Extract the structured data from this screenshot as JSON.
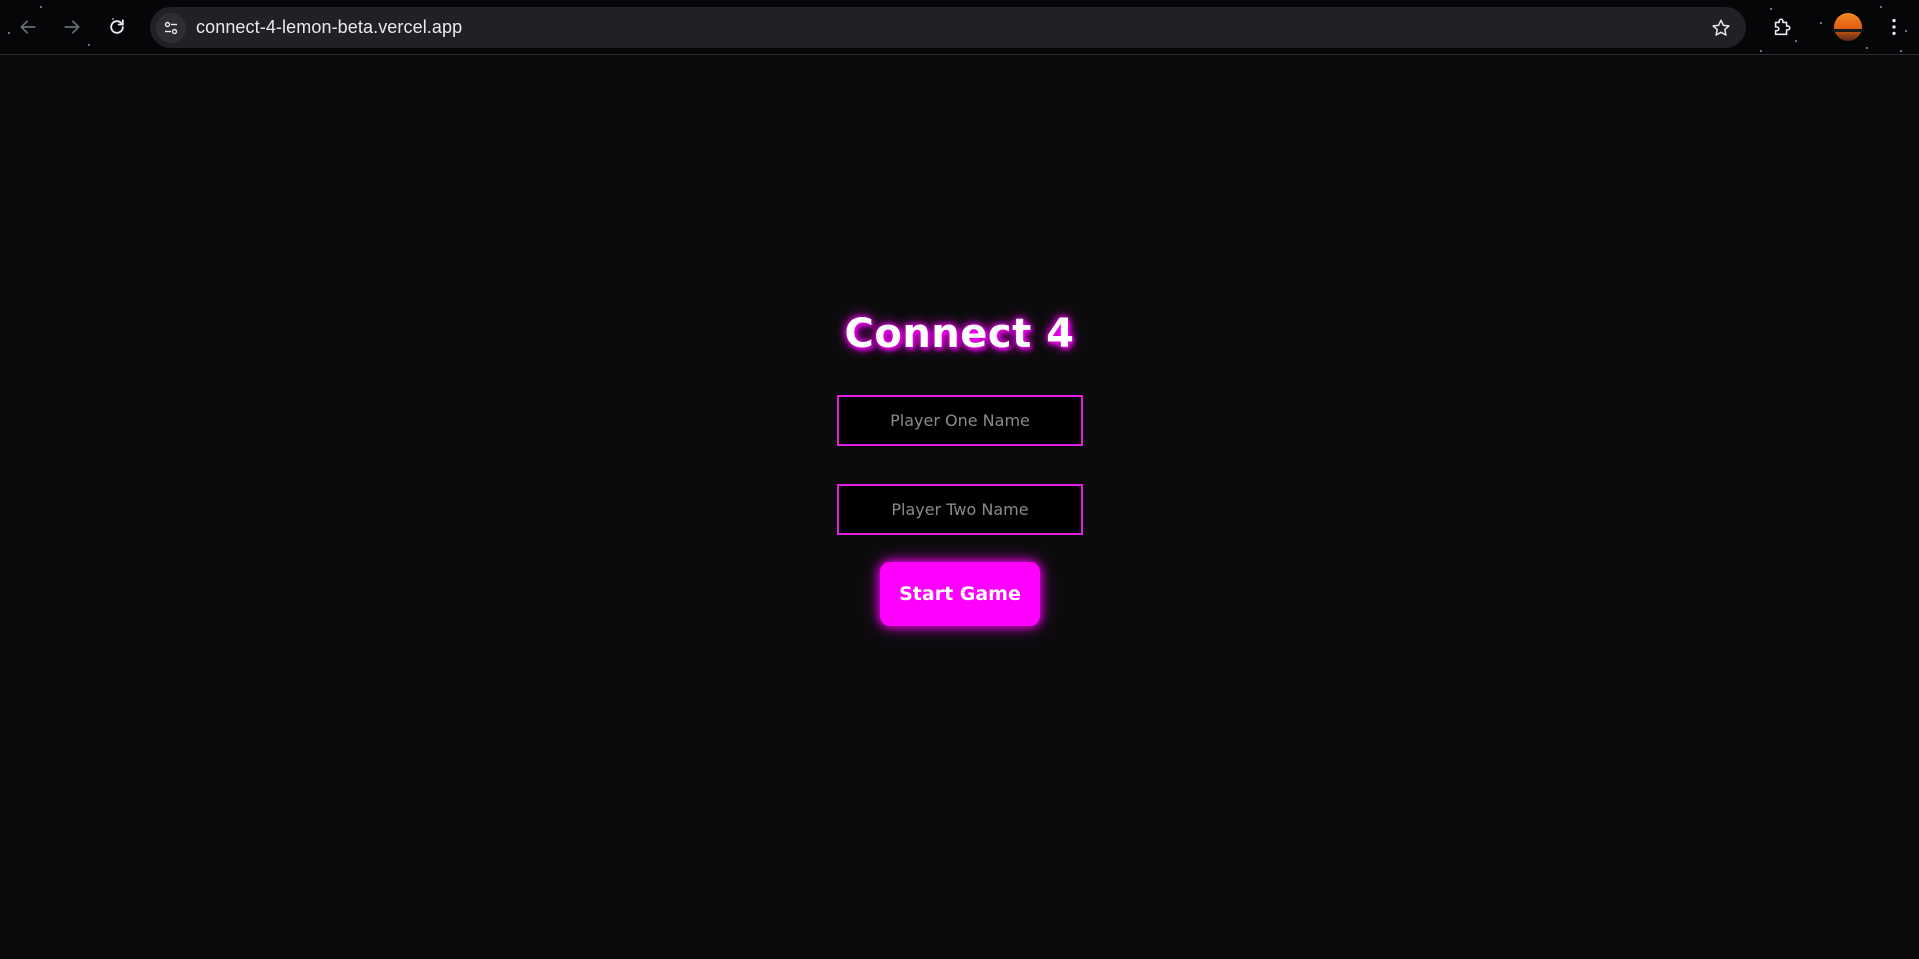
{
  "browser": {
    "url": "connect-4-lemon-beta.vercel.app",
    "icons": [
      "back-arrow-icon",
      "forward-arrow-icon",
      "reload-icon",
      "site-info-icon",
      "bookmark-star-icon",
      "extensions-icon",
      "profile-avatar",
      "kebab-menu-icon"
    ]
  },
  "game": {
    "title": "Connect 4",
    "player_one_placeholder": "Player One Name",
    "player_two_placeholder": "Player Two Name",
    "start_label": "Start Game"
  },
  "colors": {
    "accent": "#ff00ff",
    "input_border": "#e01fe0",
    "background": "#0b0b0c"
  }
}
